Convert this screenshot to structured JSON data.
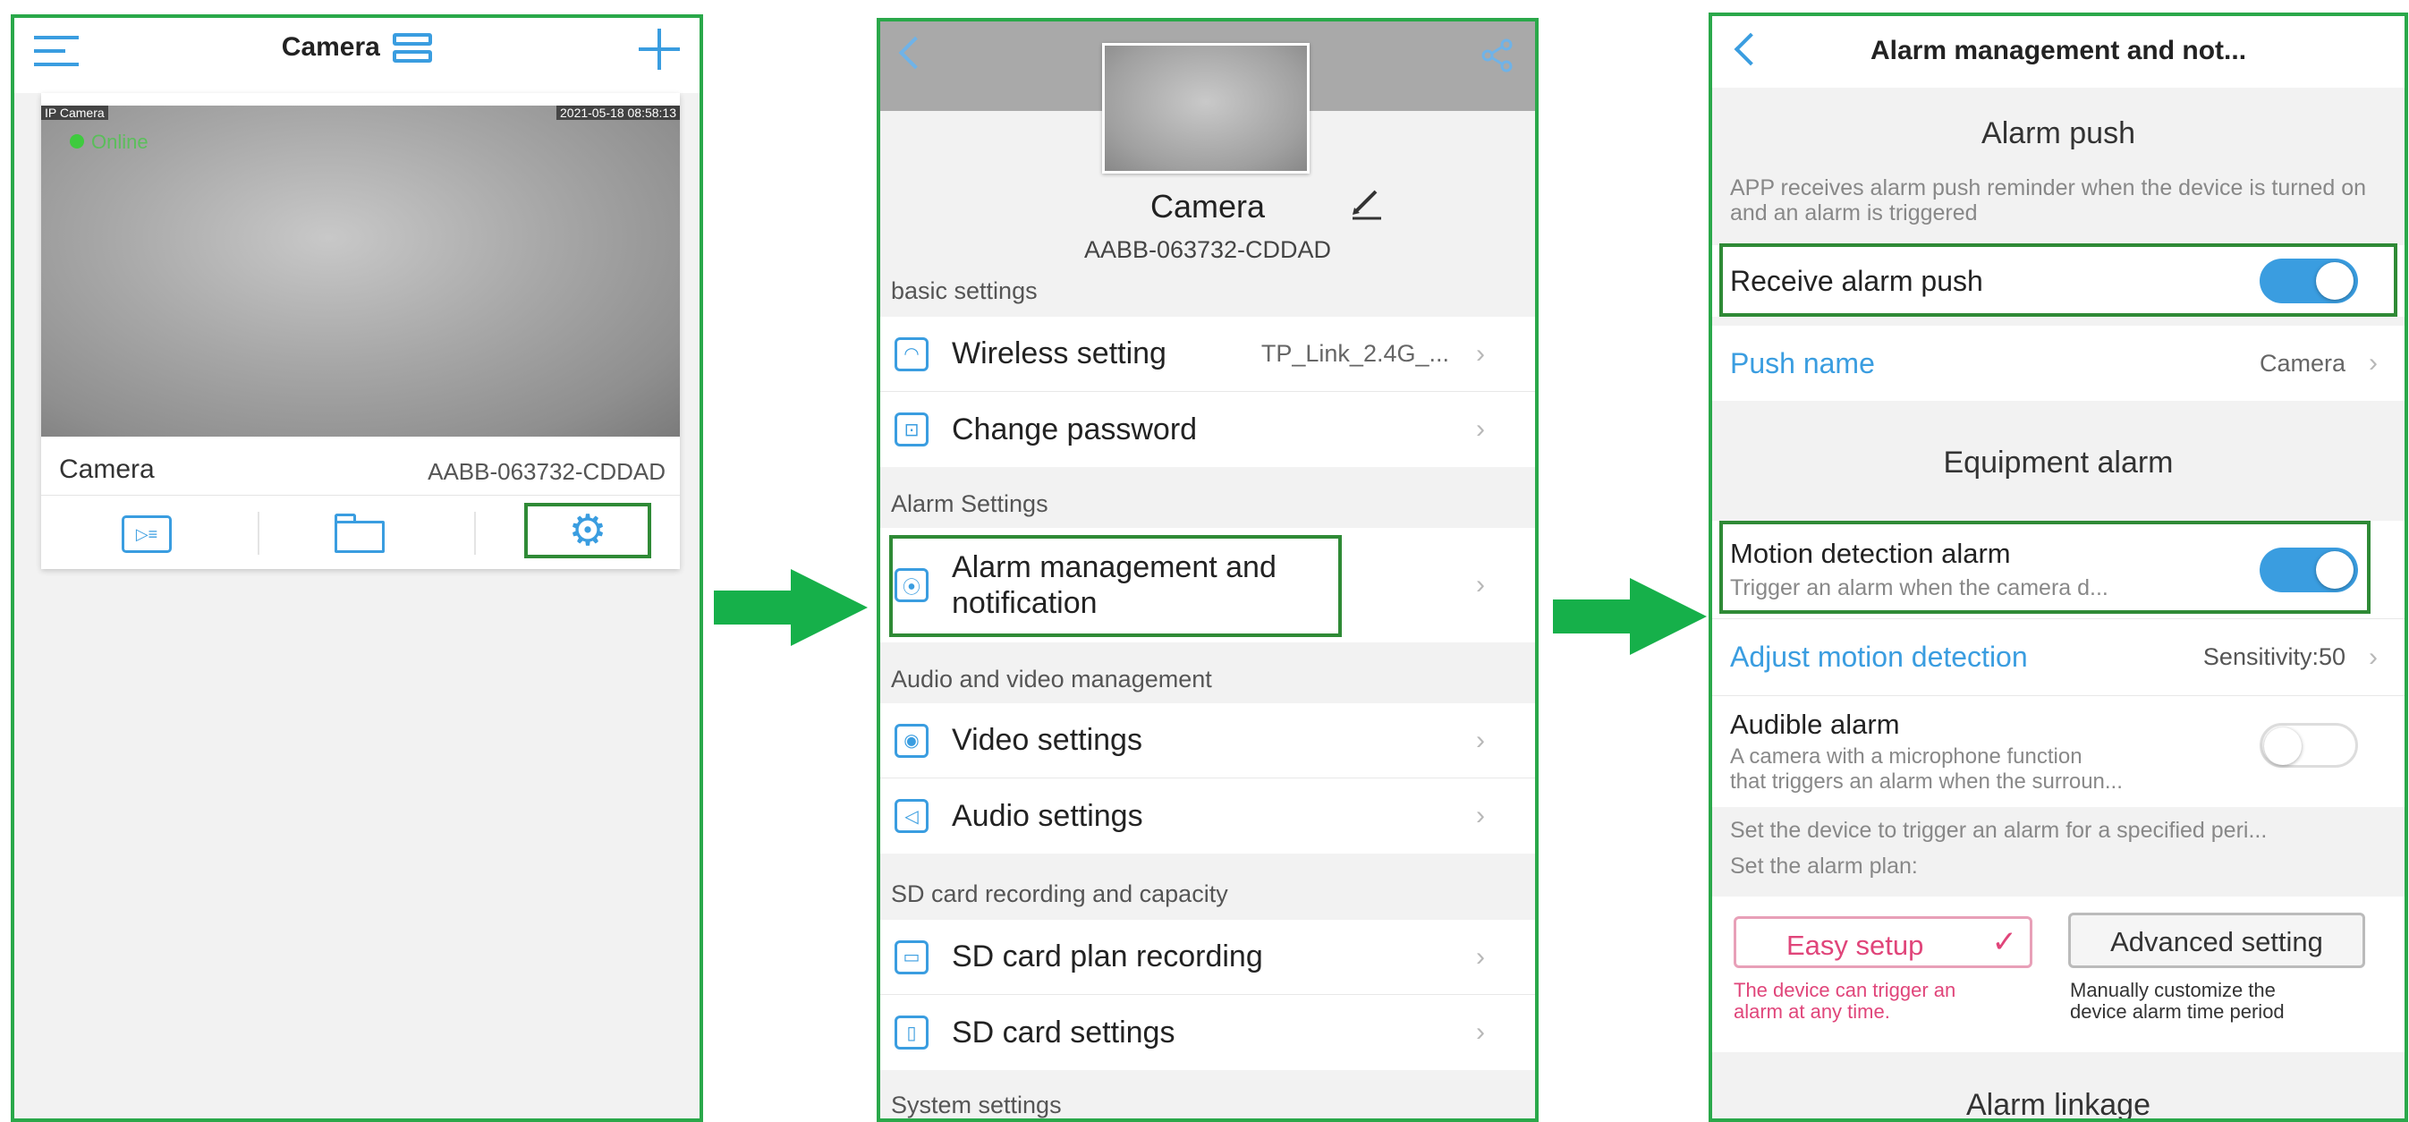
{
  "panel1": {
    "header_title": "Camera",
    "overlay_left": "IP Camera",
    "overlay_time": "2021-05-18 08:58:13",
    "status": "Online",
    "camera_name": "Camera",
    "camera_id": "AABB-063732-CDDAD"
  },
  "panel2": {
    "device_name": "Camera",
    "device_id": "AABB-063732-CDDAD",
    "sections": {
      "basic": "basic settings",
      "alarm": "Alarm Settings",
      "av": "Audio and video management",
      "sd": "SD card recording and capacity",
      "system": "System settings"
    },
    "items": {
      "wireless": "Wireless setting",
      "wireless_value": "TP_Link_2.4G_...",
      "password": "Change password",
      "alarm_mgmt": "Alarm management and\nnotification",
      "video": "Video settings",
      "audio": "Audio settings",
      "sd_plan": "SD card plan recording",
      "sd_settings": "SD card settings"
    }
  },
  "panel3": {
    "title": "Alarm management and not...",
    "alarm_push_heading": "Alarm push",
    "alarm_push_desc": "APP receives alarm push reminder when the device is turned on and an alarm is triggered",
    "receive_push": "Receive alarm push",
    "receive_push_on": true,
    "push_name_label": "Push name",
    "push_name_value": "Camera",
    "equipment_heading": "Equipment alarm",
    "motion_label": "Motion detection alarm",
    "motion_desc": "Trigger an alarm when the camera d...",
    "motion_on": true,
    "adjust_label": "Adjust motion detection",
    "adjust_value": "Sensitivity:50",
    "audible_label": "Audible alarm",
    "audible_desc_1": "A camera with a microphone function",
    "audible_desc_2": "that triggers an alarm when the surroun...",
    "audible_on": false,
    "plan_line_1": "Set the device to trigger an alarm for a specified peri...",
    "plan_line_2": "Set the alarm plan:",
    "easy_setup": "Easy setup",
    "easy_desc_1": "The device can trigger an",
    "easy_desc_2": "alarm at any time.",
    "advanced_setting": "Advanced setting",
    "advanced_desc_1": "Manually customize the",
    "advanced_desc_2": "device alarm time period",
    "linkage_heading": "Alarm linkage"
  },
  "colors": {
    "accent": "#3a9de0",
    "highlight": "#2f8a36",
    "arrow": "#16b04a",
    "pink": "#e0457a"
  }
}
